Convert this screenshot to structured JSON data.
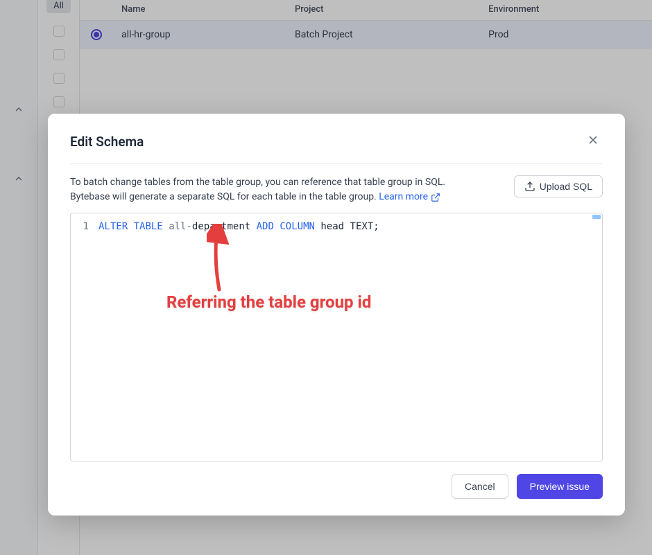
{
  "sidebar": {
    "all_label": "All"
  },
  "table": {
    "headers": {
      "name": "Name",
      "project": "Project",
      "environment": "Environment"
    },
    "row": {
      "name": "all-hr-group",
      "project": "Batch Project",
      "environment": "Prod"
    }
  },
  "modal": {
    "title": "Edit Schema",
    "description": "To batch change tables from the table group, you can reference that table group in SQL. Bytebase will generate a separate SQL for each table in the table group.  ",
    "learn_more": "Learn more",
    "upload_label": "Upload SQL",
    "line_number": "1",
    "sql": {
      "p1": "ALTER",
      "p2": "TABLE",
      "p3": "all-",
      "p4": "department ",
      "p5": "ADD",
      "p6": "COLUMN",
      "p7": " head TEXT;"
    },
    "cancel": "Cancel",
    "preview": "Preview issue"
  },
  "annotation": {
    "text": "Referring the table group id"
  }
}
